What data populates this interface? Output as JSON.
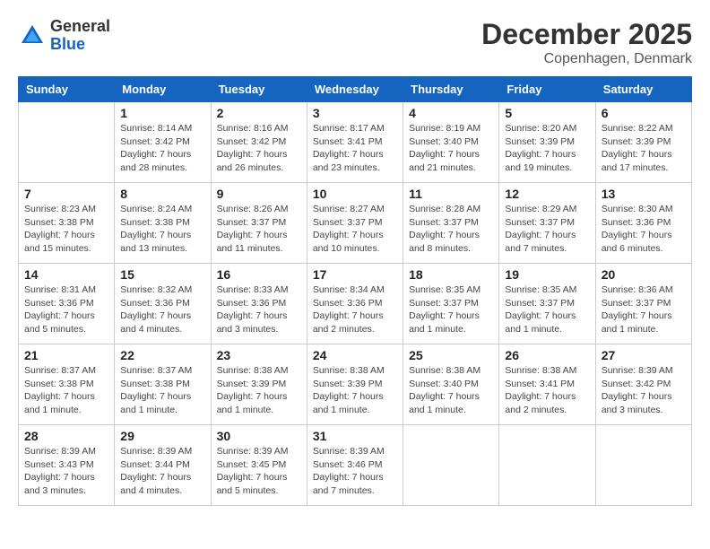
{
  "header": {
    "logo": {
      "general": "General",
      "blue": "Blue"
    },
    "title": "December 2025",
    "location": "Copenhagen, Denmark"
  },
  "columns": [
    "Sunday",
    "Monday",
    "Tuesday",
    "Wednesday",
    "Thursday",
    "Friday",
    "Saturday"
  ],
  "weeks": [
    [
      {
        "day": "",
        "info": ""
      },
      {
        "day": "1",
        "info": "Sunrise: 8:14 AM\nSunset: 3:42 PM\nDaylight: 7 hours\nand 28 minutes."
      },
      {
        "day": "2",
        "info": "Sunrise: 8:16 AM\nSunset: 3:42 PM\nDaylight: 7 hours\nand 26 minutes."
      },
      {
        "day": "3",
        "info": "Sunrise: 8:17 AM\nSunset: 3:41 PM\nDaylight: 7 hours\nand 23 minutes."
      },
      {
        "day": "4",
        "info": "Sunrise: 8:19 AM\nSunset: 3:40 PM\nDaylight: 7 hours\nand 21 minutes."
      },
      {
        "day": "5",
        "info": "Sunrise: 8:20 AM\nSunset: 3:39 PM\nDaylight: 7 hours\nand 19 minutes."
      },
      {
        "day": "6",
        "info": "Sunrise: 8:22 AM\nSunset: 3:39 PM\nDaylight: 7 hours\nand 17 minutes."
      }
    ],
    [
      {
        "day": "7",
        "info": "Sunrise: 8:23 AM\nSunset: 3:38 PM\nDaylight: 7 hours\nand 15 minutes."
      },
      {
        "day": "8",
        "info": "Sunrise: 8:24 AM\nSunset: 3:38 PM\nDaylight: 7 hours\nand 13 minutes."
      },
      {
        "day": "9",
        "info": "Sunrise: 8:26 AM\nSunset: 3:37 PM\nDaylight: 7 hours\nand 11 minutes."
      },
      {
        "day": "10",
        "info": "Sunrise: 8:27 AM\nSunset: 3:37 PM\nDaylight: 7 hours\nand 10 minutes."
      },
      {
        "day": "11",
        "info": "Sunrise: 8:28 AM\nSunset: 3:37 PM\nDaylight: 7 hours\nand 8 minutes."
      },
      {
        "day": "12",
        "info": "Sunrise: 8:29 AM\nSunset: 3:37 PM\nDaylight: 7 hours\nand 7 minutes."
      },
      {
        "day": "13",
        "info": "Sunrise: 8:30 AM\nSunset: 3:36 PM\nDaylight: 7 hours\nand 6 minutes."
      }
    ],
    [
      {
        "day": "14",
        "info": "Sunrise: 8:31 AM\nSunset: 3:36 PM\nDaylight: 7 hours\nand 5 minutes."
      },
      {
        "day": "15",
        "info": "Sunrise: 8:32 AM\nSunset: 3:36 PM\nDaylight: 7 hours\nand 4 minutes."
      },
      {
        "day": "16",
        "info": "Sunrise: 8:33 AM\nSunset: 3:36 PM\nDaylight: 7 hours\nand 3 minutes."
      },
      {
        "day": "17",
        "info": "Sunrise: 8:34 AM\nSunset: 3:36 PM\nDaylight: 7 hours\nand 2 minutes."
      },
      {
        "day": "18",
        "info": "Sunrise: 8:35 AM\nSunset: 3:37 PM\nDaylight: 7 hours\nand 1 minute."
      },
      {
        "day": "19",
        "info": "Sunrise: 8:35 AM\nSunset: 3:37 PM\nDaylight: 7 hours\nand 1 minute."
      },
      {
        "day": "20",
        "info": "Sunrise: 8:36 AM\nSunset: 3:37 PM\nDaylight: 7 hours\nand 1 minute."
      }
    ],
    [
      {
        "day": "21",
        "info": "Sunrise: 8:37 AM\nSunset: 3:38 PM\nDaylight: 7 hours\nand 1 minute."
      },
      {
        "day": "22",
        "info": "Sunrise: 8:37 AM\nSunset: 3:38 PM\nDaylight: 7 hours\nand 1 minute."
      },
      {
        "day": "23",
        "info": "Sunrise: 8:38 AM\nSunset: 3:39 PM\nDaylight: 7 hours\nand 1 minute."
      },
      {
        "day": "24",
        "info": "Sunrise: 8:38 AM\nSunset: 3:39 PM\nDaylight: 7 hours\nand 1 minute."
      },
      {
        "day": "25",
        "info": "Sunrise: 8:38 AM\nSunset: 3:40 PM\nDaylight: 7 hours\nand 1 minute."
      },
      {
        "day": "26",
        "info": "Sunrise: 8:38 AM\nSunset: 3:41 PM\nDaylight: 7 hours\nand 2 minutes."
      },
      {
        "day": "27",
        "info": "Sunrise: 8:39 AM\nSunset: 3:42 PM\nDaylight: 7 hours\nand 3 minutes."
      }
    ],
    [
      {
        "day": "28",
        "info": "Sunrise: 8:39 AM\nSunset: 3:43 PM\nDaylight: 7 hours\nand 3 minutes."
      },
      {
        "day": "29",
        "info": "Sunrise: 8:39 AM\nSunset: 3:44 PM\nDaylight: 7 hours\nand 4 minutes."
      },
      {
        "day": "30",
        "info": "Sunrise: 8:39 AM\nSunset: 3:45 PM\nDaylight: 7 hours\nand 5 minutes."
      },
      {
        "day": "31",
        "info": "Sunrise: 8:39 AM\nSunset: 3:46 PM\nDaylight: 7 hours\nand 7 minutes."
      },
      {
        "day": "",
        "info": ""
      },
      {
        "day": "",
        "info": ""
      },
      {
        "day": "",
        "info": ""
      }
    ]
  ]
}
